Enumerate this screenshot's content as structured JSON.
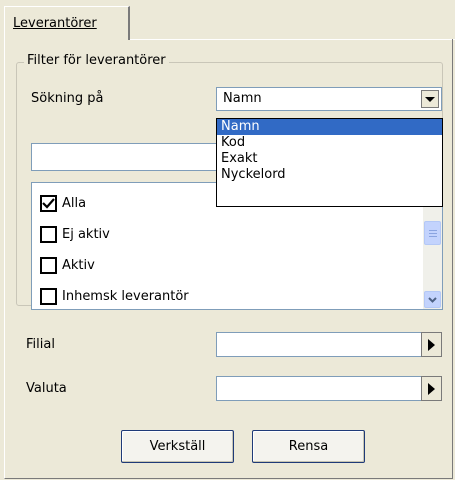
{
  "tab": {
    "label": "Leverantörer"
  },
  "filter": {
    "legend": "Filter för leverantörer",
    "search_on_label": "Sökning på",
    "search_on_value": "Namn",
    "options": [
      "Namn",
      "Kod",
      "Exakt",
      "Nyckelord"
    ],
    "selected_option_index": 0,
    "search_text_value": "",
    "list_items": [
      {
        "label": "Alla",
        "checked": true
      },
      {
        "label": "Ej aktiv",
        "checked": false
      },
      {
        "label": "Aktiv",
        "checked": false
      },
      {
        "label": "Inhemsk leverantör",
        "checked": false
      }
    ]
  },
  "fields": {
    "filial_label": "Filial",
    "filial_value": "",
    "valuta_label": "Valuta",
    "valuta_value": ""
  },
  "buttons": {
    "apply_label": "Verkställ",
    "clear_label": "Rensa"
  },
  "icons": {
    "dropdown": "chevron-down-icon",
    "lookup": "triangle-right-icon",
    "checkbox": "checkmark-icon",
    "scroll_down": "scroll-down-icon"
  },
  "colors": {
    "background": "#ece9d8",
    "selection": "#316ac5"
  }
}
